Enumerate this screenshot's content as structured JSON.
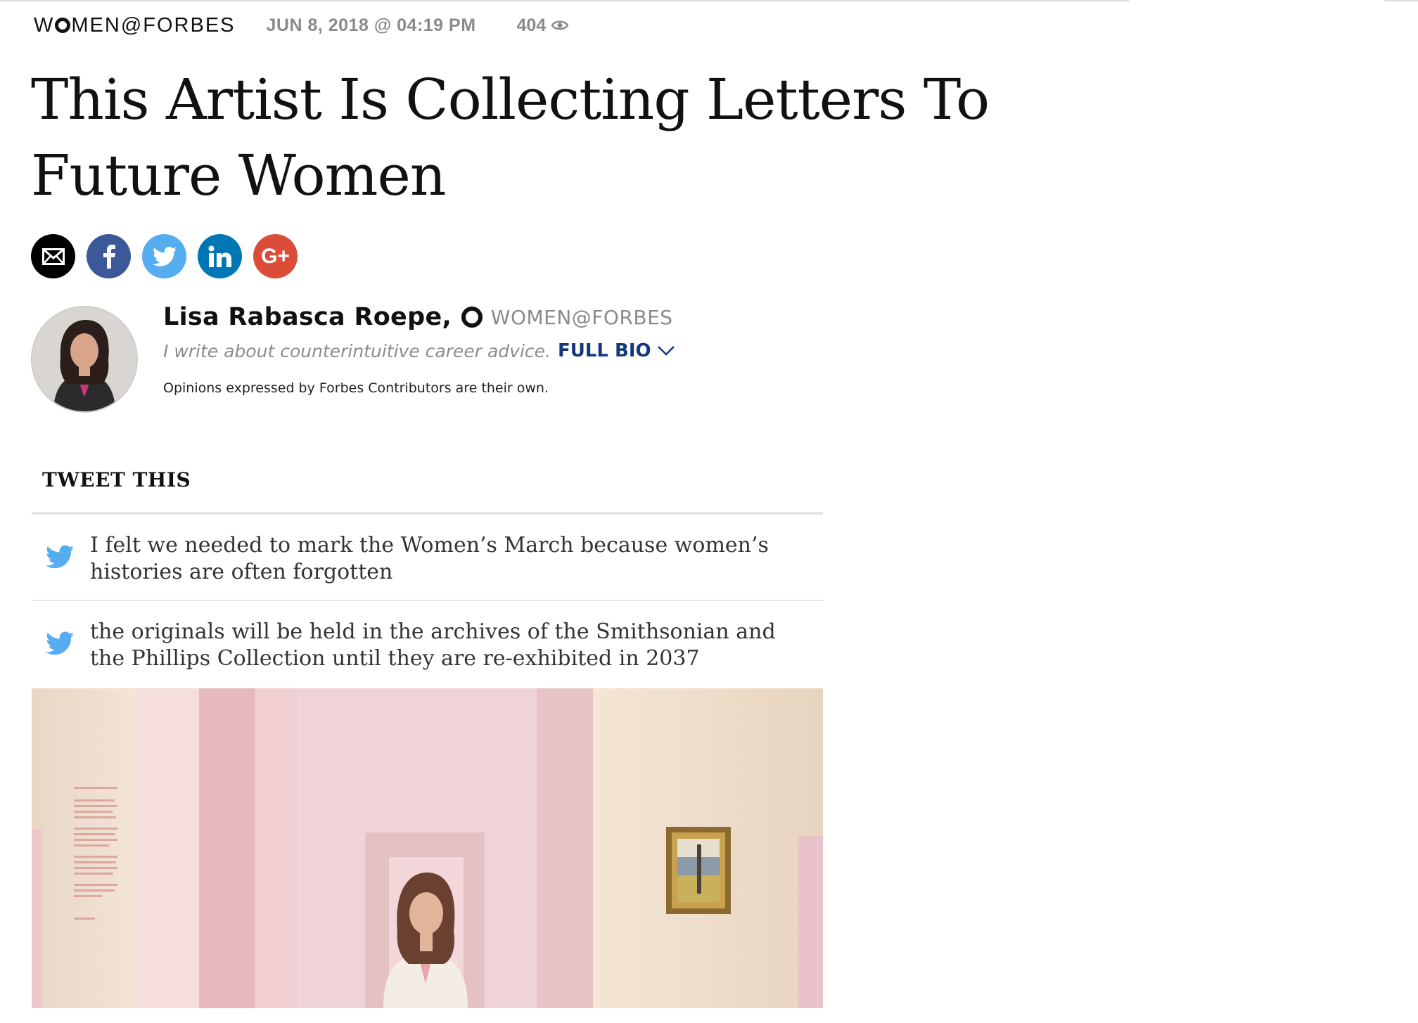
{
  "header": {
    "brand_prefix": "W",
    "brand_suffix": "MEN@FORBES",
    "date": "JUN 8, 2018 @ 04:19 PM",
    "views": "404",
    "views_icon": "eye-icon"
  },
  "article": {
    "title": "This Artist Is Collecting Letters To Future Women"
  },
  "share": {
    "buttons": [
      {
        "name": "email",
        "icon": "envelope-icon",
        "color": "#000000"
      },
      {
        "name": "facebook",
        "icon": "facebook-icon",
        "color": "#3b5998"
      },
      {
        "name": "twitter",
        "icon": "twitter-icon",
        "color": "#55acee"
      },
      {
        "name": "linkedin",
        "icon": "linkedin-icon",
        "color": "#0077b5"
      },
      {
        "name": "google-plus",
        "icon": "google-plus-icon",
        "label": "G+",
        "color": "#dd4b39"
      }
    ]
  },
  "author": {
    "name": "Lisa Rabasca Roepe",
    "separator": ",",
    "publication": "WOMEN@FORBES",
    "tagline": "I write about counterintuitive career advice.",
    "full_bio_label": "FULL BIO",
    "disclaimer": "Opinions expressed by Forbes Contributors are their own."
  },
  "tweet_this": {
    "heading": "TWEET THIS",
    "items": [
      {
        "text": "I felt we needed to mark the Women’s March because women’s histories are often forgotten"
      },
      {
        "text": "the originals will be held in the archives of the Smithsonian and the Phillips Collection until they are re-exhibited in 2037"
      }
    ]
  },
  "colors": {
    "link_blue": "#14367a",
    "meta_gray": "#8a8a8a",
    "twitter_blue": "#55acee"
  }
}
